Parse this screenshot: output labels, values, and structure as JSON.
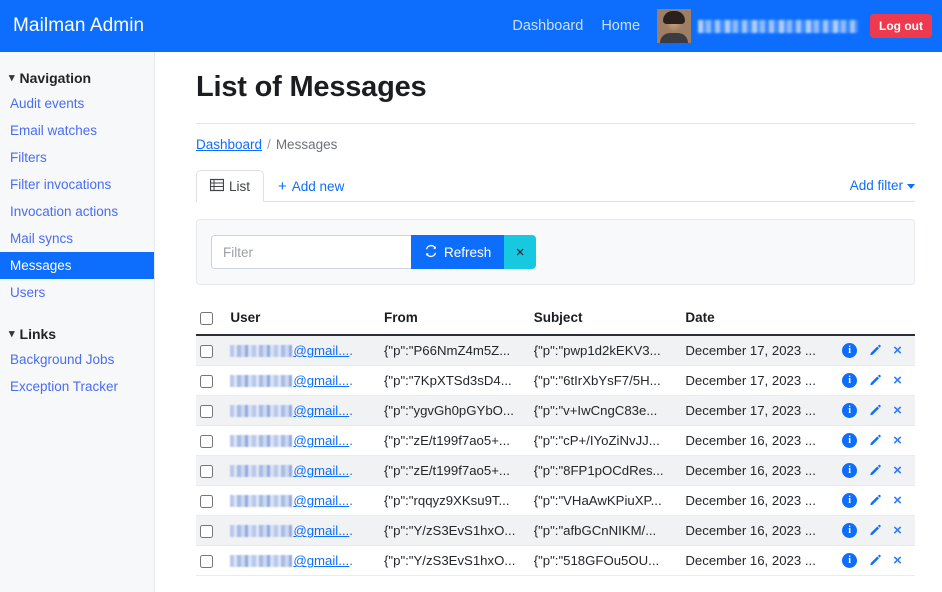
{
  "navbar": {
    "brand": "Mailman Admin",
    "links": [
      {
        "label": "Dashboard",
        "name": "nav-link-dashboard"
      },
      {
        "label": "Home",
        "name": "nav-link-home"
      }
    ],
    "user_email": "",
    "logout_label": "Log out",
    "background_color": "#0d6efd",
    "logout_color": "#ee3a4e"
  },
  "sidebar": {
    "sections": [
      {
        "title": "Navigation",
        "items": [
          {
            "label": "Audit events",
            "active": false
          },
          {
            "label": "Email watches",
            "active": false
          },
          {
            "label": "Filters",
            "active": false
          },
          {
            "label": "Filter invocations",
            "active": false
          },
          {
            "label": "Invocation actions",
            "active": false
          },
          {
            "label": "Mail syncs",
            "active": false
          },
          {
            "label": "Messages",
            "active": true
          },
          {
            "label": "Users",
            "active": false
          }
        ]
      },
      {
        "title": "Links",
        "items": [
          {
            "label": "Background Jobs",
            "active": false
          },
          {
            "label": "Exception Tracker",
            "active": false
          }
        ]
      }
    ],
    "active_color": "#0d6efd"
  },
  "main": {
    "page_title": "List of Messages",
    "breadcrumb": {
      "root": "Dashboard",
      "separator": "/",
      "current": "Messages"
    },
    "tabs": [
      {
        "label": "List",
        "icon": "table-icon",
        "active": true
      },
      {
        "label": "Add new",
        "icon": "plus-icon",
        "active": false
      }
    ],
    "add_filter_label": "Add filter",
    "filter": {
      "placeholder": "Filter",
      "value": "",
      "refresh_label": "Refresh",
      "clear_label": "×"
    },
    "table": {
      "columns": [
        "User",
        "From",
        "Subject",
        "Date"
      ],
      "rows": [
        {
          "user_suffix": "@gmail...",
          "from": "{\"p\":\"P66NmZ4m5Z...",
          "subject": "{\"p\":\"pwp1d2kEKV3...",
          "date": "December 17, 2023 ..."
        },
        {
          "user_suffix": "@gmail...",
          "from": "{\"p\":\"7KpXTSd3sD4...",
          "subject": "{\"p\":\"6tIrXbYsF7/5H...",
          "date": "December 17, 2023 ..."
        },
        {
          "user_suffix": "@gmail...",
          "from": "{\"p\":\"ygvGh0pGYbO...",
          "subject": "{\"p\":\"v+IwCngC83e...",
          "date": "December 17, 2023 ..."
        },
        {
          "user_suffix": "@gmail...",
          "from": "{\"p\":\"zE/t199f7ao5+...",
          "subject": "{\"p\":\"cP+/IYoZiNvJJ...",
          "date": "December 16, 2023 ..."
        },
        {
          "user_suffix": "@gmail...",
          "from": "{\"p\":\"zE/t199f7ao5+...",
          "subject": "{\"p\":\"8FP1pOCdRes...",
          "date": "December 16, 2023 ..."
        },
        {
          "user_suffix": "@gmail...",
          "from": "{\"p\":\"rqqyz9XKsu9T...",
          "subject": "{\"p\":\"VHaAwKPiuXP...",
          "date": "December 16, 2023 ..."
        },
        {
          "user_suffix": "@gmail...",
          "from": "{\"p\":\"Y/zS3EvS1hxO...",
          "subject": "{\"p\":\"afbGCnNIKM/...",
          "date": "December 16, 2023 ..."
        },
        {
          "user_suffix": "@gmail...",
          "from": "{\"p\":\"Y/zS3EvS1hxO...",
          "subject": "{\"p\":\"518GFOu5OU...",
          "date": "December 16, 2023 ..."
        }
      ],
      "row_actions": {
        "info_glyph": "i",
        "delete_glyph": "×"
      }
    }
  }
}
